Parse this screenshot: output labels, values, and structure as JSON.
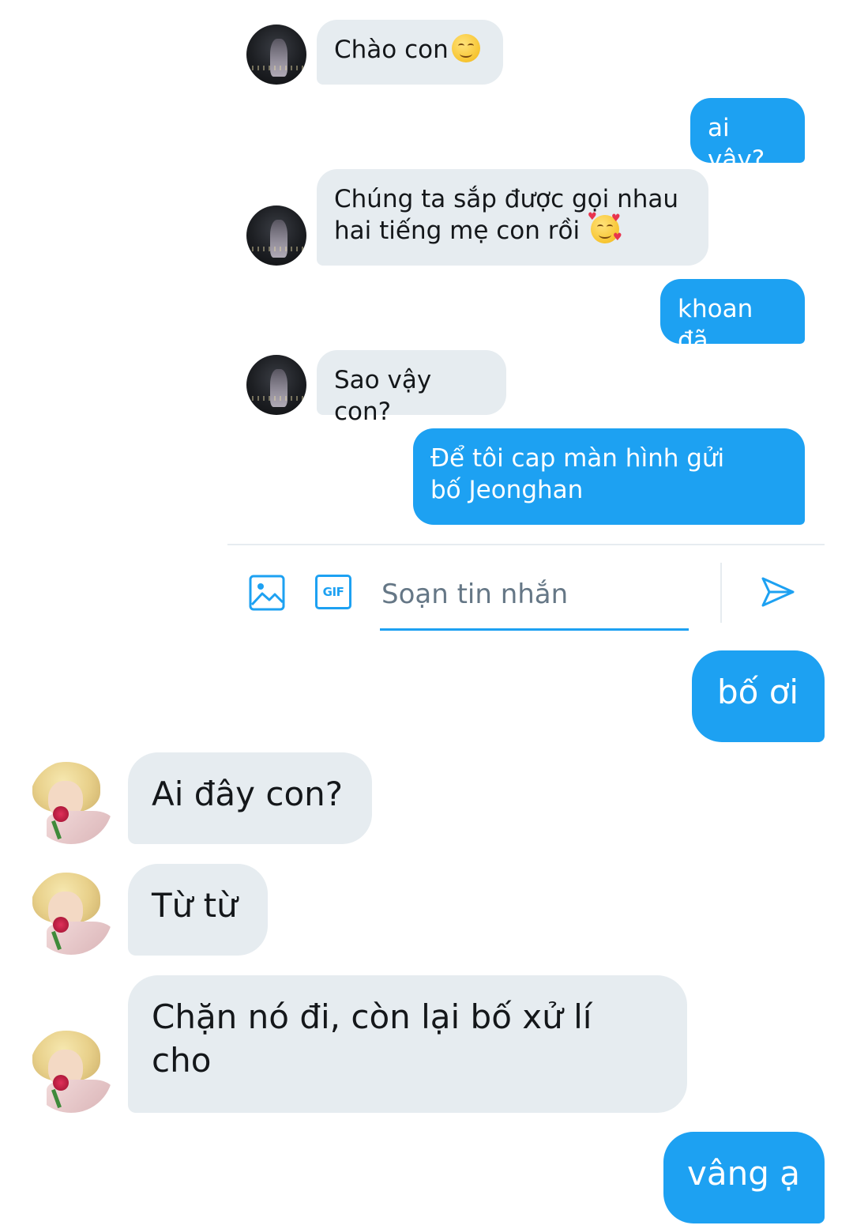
{
  "thread_top": {
    "messages": [
      {
        "side": "in",
        "text": "Chào con",
        "emoji": "smiling-face-icon"
      },
      {
        "side": "out",
        "text": "ai vậy?"
      },
      {
        "side": "in",
        "text": "Chúng ta sắp được gọi nhau hai tiếng mẹ con rồi",
        "emoji": "smiling-face-with-hearts-icon"
      },
      {
        "side": "out",
        "text": "khoan đã"
      },
      {
        "side": "in",
        "text": "Sao vậy con?"
      },
      {
        "side": "out",
        "text": "Để tôi cap màn hình gửi bố Jeonghan"
      }
    ]
  },
  "composer": {
    "image_icon": "image-icon",
    "gif_icon": "gif-icon",
    "gif_label": "GIF",
    "placeholder": "Soạn tin nhắn",
    "send_icon": "send-icon"
  },
  "thread_bottom": {
    "messages": [
      {
        "side": "out",
        "text": "bố ơi"
      },
      {
        "side": "in",
        "text": "Ai đây con?"
      },
      {
        "side": "in",
        "text": "Từ từ"
      },
      {
        "side": "in",
        "text": "Chặn nó đi, còn lại bố xử lí cho"
      },
      {
        "side": "out",
        "text": "vâng ạ"
      }
    ]
  },
  "colors": {
    "outgoing_bubble": "#1da1f2",
    "incoming_bubble": "#e6ecf0",
    "accent": "#1da1f2",
    "text_dark": "#14171a",
    "placeholder": "#657786"
  }
}
